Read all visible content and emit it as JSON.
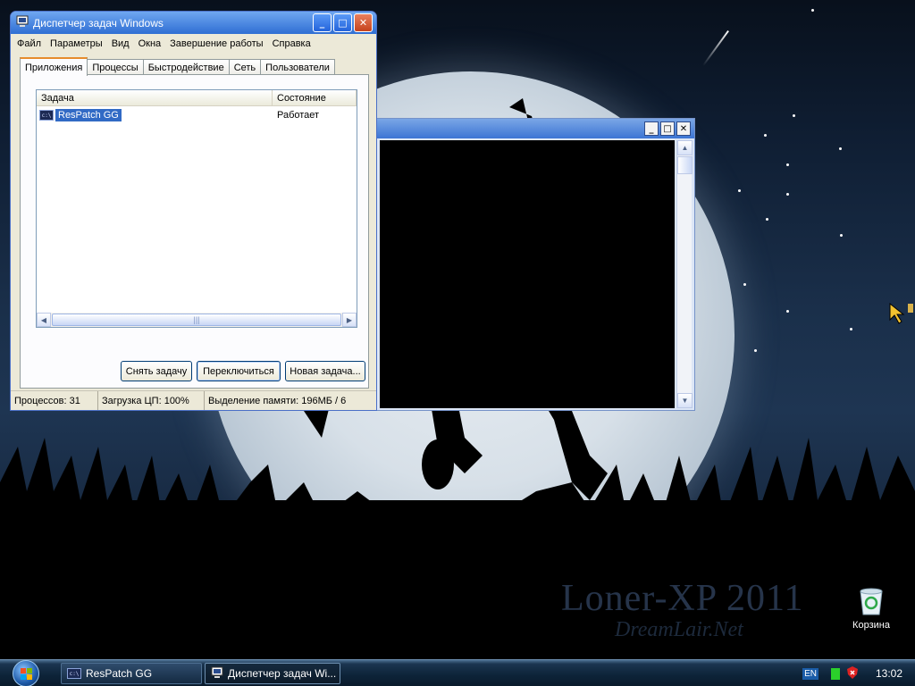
{
  "taskmgr": {
    "title": "Диспетчер задач Windows",
    "menu": [
      "Файл",
      "Параметры",
      "Вид",
      "Окна",
      "Завершение работы",
      "Справка"
    ],
    "tabs": [
      "Приложения",
      "Процессы",
      "Быстродействие",
      "Сеть",
      "Пользователи"
    ],
    "columns": [
      "Задача",
      "Состояние"
    ],
    "rows": [
      {
        "task": "ResPatch GG",
        "status": "Работает"
      }
    ],
    "buttons": {
      "end_task": "Снять задачу",
      "switch_to": "Переключиться",
      "new_task": "Новая задача..."
    },
    "status": {
      "processes": "Процессов: 31",
      "cpu": "Загрузка ЦП: 100%",
      "memory": "Выделение памяти: 196МБ / 6"
    }
  },
  "desktop": {
    "watermark": "Loner-XP 2011",
    "watermark_sub": "DreamLair.Net",
    "recycle_bin": "Корзина"
  },
  "taskbar": {
    "buttons": [
      "ResPatch GG",
      "Диспетчер задач Wi..."
    ],
    "lang": "EN",
    "clock": "13:02"
  },
  "icons": {
    "cmd": "c:\\",
    "minimize": "_",
    "maximize": "□",
    "close": "✕"
  }
}
